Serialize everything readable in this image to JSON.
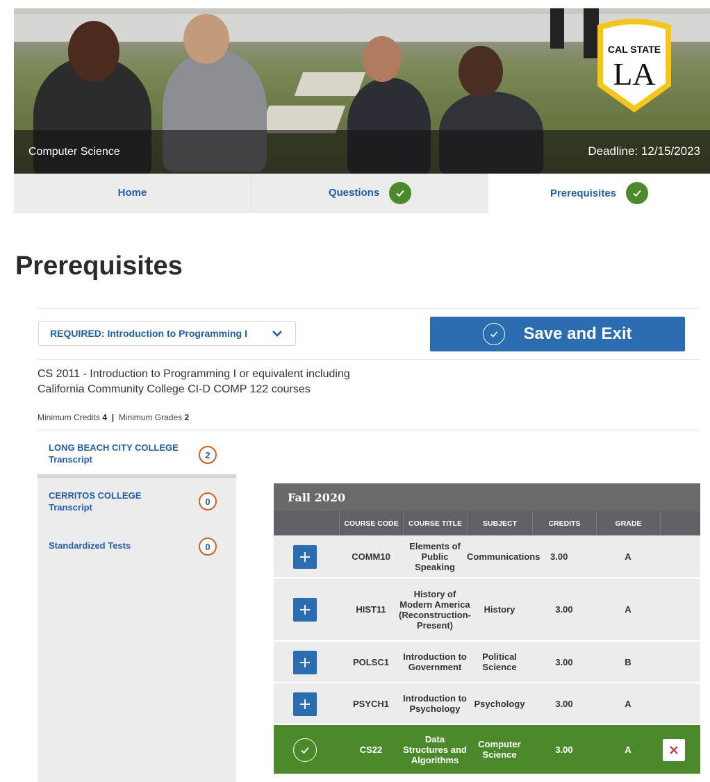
{
  "hero": {
    "program": "Computer Science",
    "deadline": "Deadline: 12/15/2023",
    "logo": {
      "line1": "CAL STATE",
      "line2": "LA"
    }
  },
  "tabs": [
    {
      "label": "Home",
      "complete": false
    },
    {
      "label": "Questions",
      "complete": true
    },
    {
      "label": "Prerequisites",
      "complete": true,
      "active": true
    }
  ],
  "page_title": "Prerequisites",
  "requirement": {
    "selected": "REQUIRED: Introduction to Programming I",
    "description": "CS 2011 - Introduction to Programming I or equivalent including California Community College CI-D COMP 122 courses",
    "min_credits_label": "Minimum Credits",
    "min_credits": "4",
    "min_grades_label": "Minimum Grades",
    "min_grades": "2"
  },
  "save_button": "Save and Exit",
  "sources": [
    {
      "label": "LONG BEACH CITY COLLEGE Transcript",
      "count": "2"
    },
    {
      "label": "CERRITOS COLLEGE Transcript",
      "count": "0"
    },
    {
      "label": "Standardized Tests",
      "count": "0"
    }
  ],
  "term": {
    "name": "Fall 2020",
    "columns": [
      "COURSE CODE",
      "COURSE TITLE",
      "SUBJECT",
      "CREDITS",
      "GRADE"
    ],
    "rows": [
      {
        "code": "COMM10",
        "title": "Elements of Public Speaking",
        "subject": "Communications",
        "credits": "3.00",
        "grade": "A",
        "selected": false
      },
      {
        "code": "HIST11",
        "title": "History of Modern America (Reconstruction-Present)",
        "subject": "History",
        "credits": "3.00",
        "grade": "A",
        "selected": false
      },
      {
        "code": "POLSC1",
        "title": "Introduction to Government",
        "subject": "Political Science",
        "credits": "3.00",
        "grade": "B",
        "selected": false
      },
      {
        "code": "PSYCH1",
        "title": "Introduction to Psychology",
        "subject": "Psychology",
        "credits": "3.00",
        "grade": "A",
        "selected": false
      },
      {
        "code": "CS22",
        "title": "Data Structures and Algorithms",
        "subject": "Computer Science",
        "credits": "3.00",
        "grade": "A",
        "selected": true
      }
    ]
  },
  "colors": {
    "brand_blue": "#2a6db0",
    "link_blue": "#1f5fa6",
    "success_green": "#4b8a2a",
    "count_orange": "#d35e1e",
    "logo_gold": "#f5c518"
  },
  "icons": {
    "tab_complete": "check-circle-icon",
    "dropdown": "chevron-down-icon",
    "save": "check-circle-outline-icon",
    "add_course": "plus-icon",
    "selected_course": "check-circle-outline-icon",
    "remove_course": "close-icon"
  }
}
